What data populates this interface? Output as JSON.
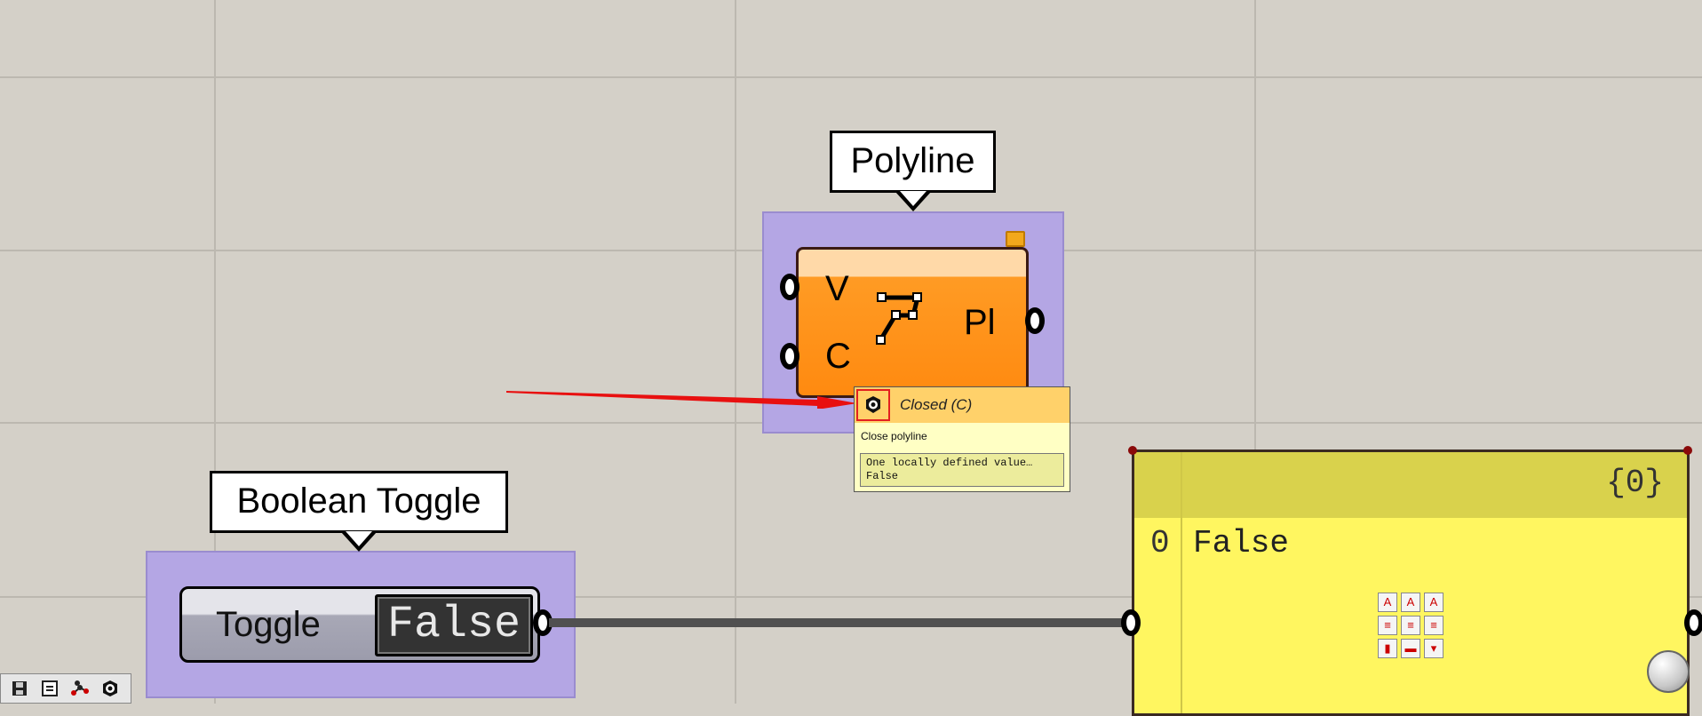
{
  "polyline_group": {
    "title": "Polyline",
    "inputs": [
      "V",
      "C"
    ],
    "output": "Pl"
  },
  "tooltip": {
    "title": "Closed (C)",
    "description": "Close polyline",
    "value_lines": [
      "One locally defined value…",
      "False"
    ]
  },
  "toggle_group": {
    "title": "Boolean Toggle",
    "label": "Toggle",
    "value": "False"
  },
  "panel": {
    "path": "{0}",
    "rows": [
      {
        "index": "0",
        "value": "False"
      }
    ]
  },
  "icons": [
    "polyline-icon",
    "cog-icon",
    "text-format-icon",
    "sphere-icon",
    "save-icon",
    "list-icon",
    "graph-icon"
  ],
  "colors": {
    "canvas": "#d4d0c8",
    "group": "#b4a6e4",
    "component": "#ff8a10",
    "panel": "#fff660",
    "arrow": "#e81010"
  }
}
